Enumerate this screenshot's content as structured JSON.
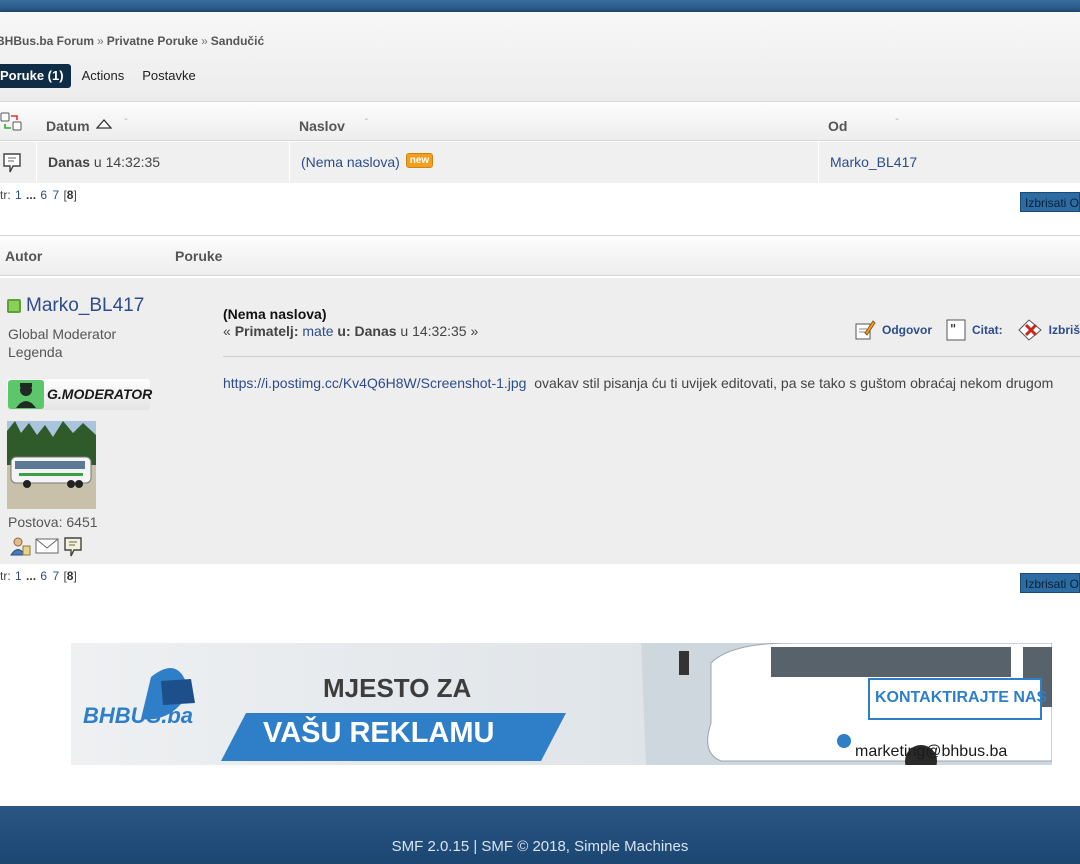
{
  "breadcrumb": [
    "BHBus.ba Forum",
    "Privatne Poruke",
    "Sandučić"
  ],
  "breadcrumb_sep": "»",
  "tabs": [
    "Poruke (1)",
    "Actions",
    "Postavke"
  ],
  "table": {
    "columns": [
      "Datum",
      "Naslov",
      "Od"
    ],
    "row": {
      "date_bold": "Danas",
      "date_rest": "u 14:32:35",
      "subject": "(Nema naslova)",
      "new_badge": "new",
      "from": "Marko_BL417"
    }
  },
  "pagination": {
    "prefix": "tr:",
    "pages": [
      "1",
      "...",
      "6",
      "7"
    ],
    "current": "8"
  },
  "delete_label": "Izbrisati O",
  "post_header": {
    "author": "Autor",
    "messages": "Poruke"
  },
  "poster": {
    "name": "Marko_BL417",
    "group": "Global Moderator",
    "rank": "Legenda",
    "badge_text": "G.MODERATOR",
    "posts": "Postova: 6451"
  },
  "post": {
    "subject": "(Nema naslova)",
    "recipient_open": "«",
    "recipient_label": "Primatelj:",
    "recipient_name": "mate",
    "date_label": "u: Danas",
    "date_time": "u 14:32:35",
    "recipient_close": "»",
    "link": "https://i.postimg.cc/Kv4Q6H8W/Screenshot-1.jpg",
    "text": "ovakav stil pisanja ću ti uvijek editovati, pa se tako s guštom obraćaj nekom drugom",
    "actions": [
      "Odgovor",
      "Citat:",
      "Izbriš"
    ]
  },
  "banner": {
    "logo": "BHBUS.ba",
    "line1": "MJESTO ZA",
    "line2": "VAŠU REKLAMU",
    "contact": "KONTAKTIRAJTE NAS",
    "email": "marketing@bhbus.ba"
  },
  "footer": "SMF 2.0.15 | SMF © 2018, Simple Machines",
  "colors": {
    "link": "#2c4c8c",
    "active_tab": "#0f2c46",
    "new_badge": "#f0a01a",
    "banner_blue": "#2f7fc8",
    "band": "#2a5684"
  }
}
